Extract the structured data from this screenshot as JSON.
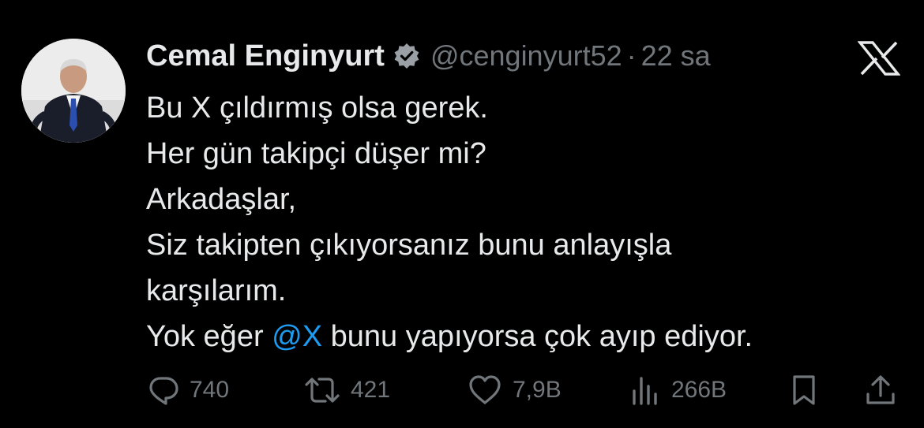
{
  "author": {
    "name": "Cemal Enginyurt",
    "handle": "@cenginyurt52",
    "separator": "·",
    "time": "22 sa",
    "verified": true
  },
  "tweet": {
    "lines": [
      "Bu X çıldırmış olsa gerek.",
      "Her gün takipçi düşer mi?",
      "Arkadaşlar,",
      "Siz takipten çıkıyorsanız bunu anlayışla",
      "karşılarım."
    ],
    "last_line": {
      "before": "Yok eğer ",
      "mention": "@X",
      "after": " bunu yapıyorsa çok ayıp ediyor."
    }
  },
  "actions": {
    "replies": "740",
    "reposts": "421",
    "likes": "7,9B",
    "views": "266B"
  },
  "colors": {
    "background": "#000000",
    "text": "#e7e9ea",
    "secondary": "#71767b",
    "accent": "#1d9bf0"
  },
  "icons": [
    "x-logo-icon",
    "verified-badge-icon",
    "reply-icon",
    "repost-icon",
    "like-icon",
    "views-icon",
    "bookmark-icon",
    "share-icon"
  ]
}
